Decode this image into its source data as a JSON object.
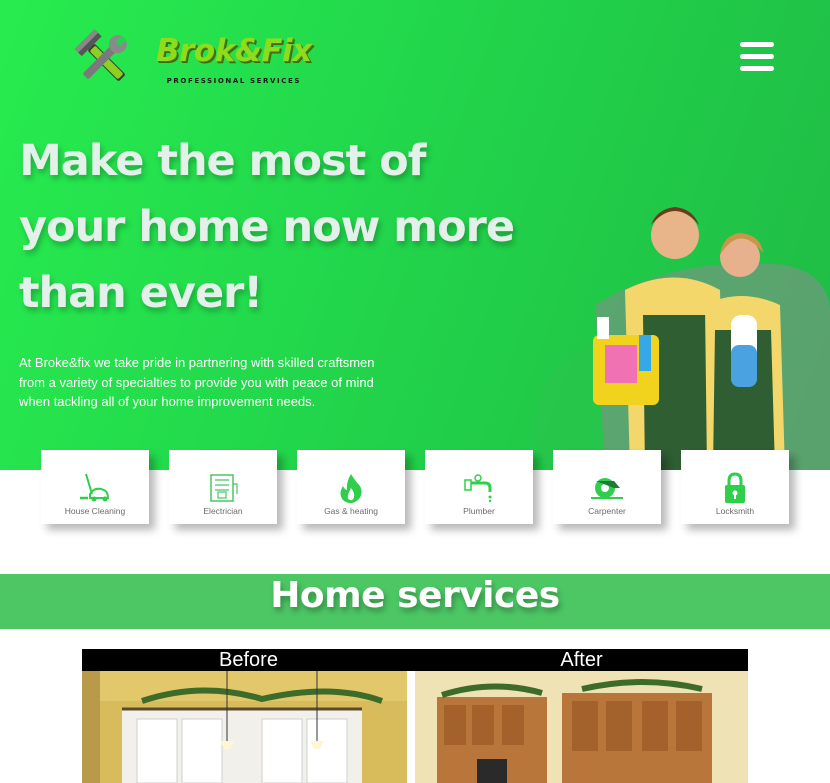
{
  "brand": {
    "name": "Brok&Fix",
    "tagline": "PROFESSIONAL SERVICES"
  },
  "header": {
    "menu_icon": "hamburger-menu-icon"
  },
  "hero": {
    "headline_lines": [
      "Make the most of",
      "your home now more",
      "than ever!"
    ],
    "intro_lines": [
      "At Broke&fix we take pride in partnering with skilled craftsmen",
      "from a variety of specialties to provide you with peace of mind",
      "when tackling all of your home improvement needs."
    ]
  },
  "services": [
    {
      "label": "House Cleaning",
      "icon": "vacuum-icon"
    },
    {
      "label": "Electrician",
      "icon": "electrical-panel-icon"
    },
    {
      "label": "Gas & heating",
      "icon": "flame-icon"
    },
    {
      "label": "Plumber",
      "icon": "faucet-icon"
    },
    {
      "label": "Carpenter",
      "icon": "circular-saw-icon"
    },
    {
      "label": "Locksmith",
      "icon": "padlock-icon"
    }
  ],
  "section": {
    "title": "Home services"
  },
  "before_after": {
    "before_label": "Before",
    "after_label": "After"
  },
  "colors": {
    "hero_green": "#22d64b",
    "band_green": "#4cc764",
    "icon_green": "#2fcf4b",
    "white": "#ffffff"
  }
}
